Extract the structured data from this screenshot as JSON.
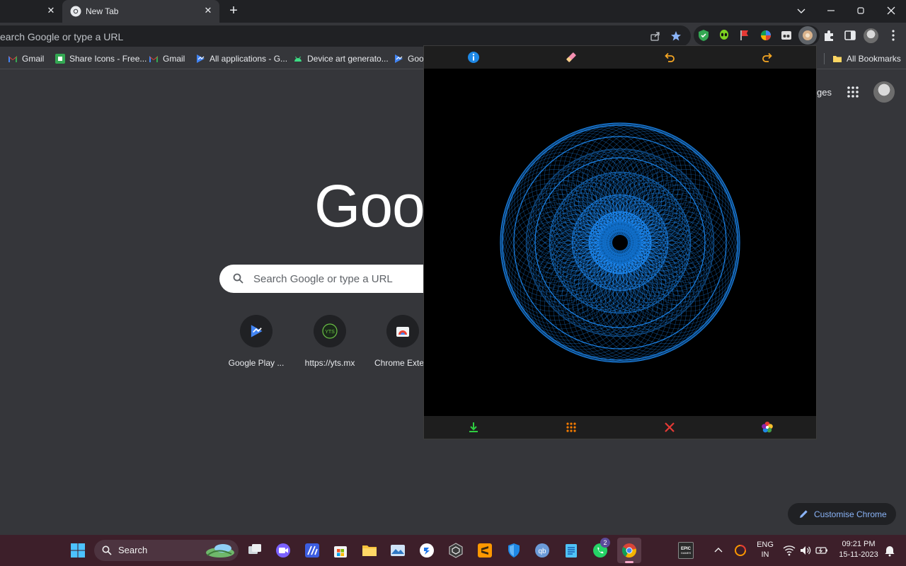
{
  "tabs": [
    {
      "title": "New Tab",
      "close": "✕"
    }
  ],
  "prev_tab_close": "✕",
  "new_tab": "+",
  "omnibox": {
    "text": "earch Google or type a URL"
  },
  "bookmarks": [
    {
      "label": "Gmail",
      "icon": "gmail-icon"
    },
    {
      "label": "Share Icons - Free...",
      "icon": "share-icons-icon"
    },
    {
      "label": "Gmail",
      "icon": "gmail-icon"
    },
    {
      "label": "All applications - G...",
      "icon": "play-console-icon"
    },
    {
      "label": "Device art generato...",
      "icon": "android-icon"
    },
    {
      "label": "Goo",
      "icon": "play-console-icon"
    }
  ],
  "all_bookmarks": "All Bookmarks",
  "ntp": {
    "logo": "Goo",
    "images_partial": "ges",
    "search_placeholder": "Search Google or type a URL",
    "shortcuts": [
      {
        "label": "Google Play ...",
        "icon": "play-console-icon"
      },
      {
        "label": "https://yts.mx",
        "icon": "yts-icon"
      },
      {
        "label": "Chrome Exte...",
        "icon": "chrome-web-store-icon"
      }
    ],
    "customise": "Customise Chrome"
  },
  "taskbar": {
    "search": "Search",
    "whatsapp_badge": "2",
    "lang": "ENG",
    "region": "IN",
    "time": "09:21 PM",
    "date": "15-11-2023"
  },
  "colors": {
    "accent": "#8ab4f8",
    "spiro": "#1e90ff",
    "popup_bg": "#000000"
  }
}
